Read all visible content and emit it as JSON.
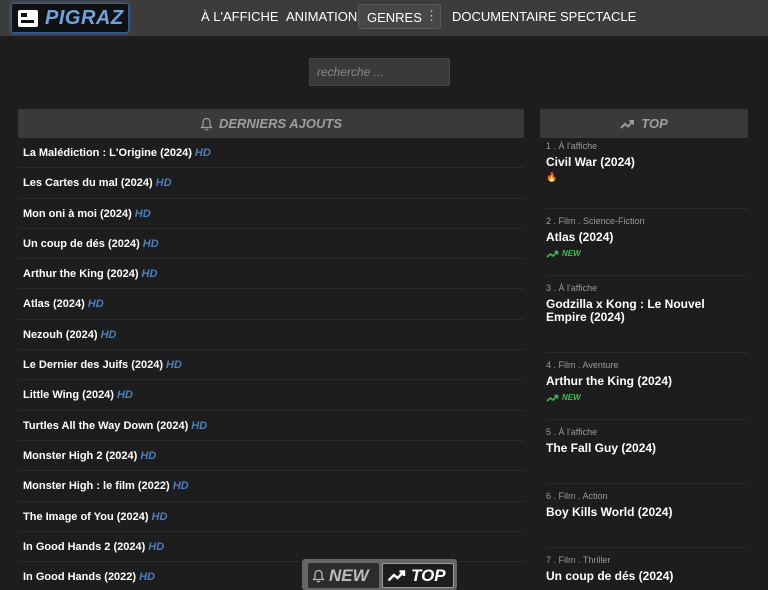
{
  "header": {
    "logo_text": "PIGRAZ",
    "nav": [
      {
        "label": "À L'AFFICHE"
      },
      {
        "label": "ANIMATION"
      },
      {
        "label": "GENRES"
      },
      {
        "label": "DOCUMENTAIRE"
      },
      {
        "label": "SPECTACLE"
      }
    ]
  },
  "search": {
    "placeholder": "recherche ..."
  },
  "latest": {
    "title": "DERNIERS AJOUTS",
    "items": [
      {
        "title": "La Malédiction : L'Origine (2024)",
        "tag": "HD"
      },
      {
        "title": "Les Cartes du mal (2024)",
        "tag": "HD"
      },
      {
        "title": "Mon oni à moi (2024)",
        "tag": "HD"
      },
      {
        "title": "Un coup de dés (2024)",
        "tag": "HD"
      },
      {
        "title": "Arthur the King (2024)",
        "tag": "HD"
      },
      {
        "title": "Atlas (2024)",
        "tag": "HD"
      },
      {
        "title": "Nezouh (2024)",
        "tag": "HD"
      },
      {
        "title": "Le Dernier des Juifs (2024)",
        "tag": "HD"
      },
      {
        "title": "Little Wing (2024)",
        "tag": "HD"
      },
      {
        "title": "Turtles All the Way Down (2024)",
        "tag": "HD"
      },
      {
        "title": "Monster High 2 (2024)",
        "tag": "HD"
      },
      {
        "title": "Monster High : le film (2022)",
        "tag": "HD"
      },
      {
        "title": "The Image of You (2024)",
        "tag": "HD"
      },
      {
        "title": "In Good Hands 2 (2024)",
        "tag": "HD"
      },
      {
        "title": "In Good Hands (2022)",
        "tag": "HD"
      }
    ]
  },
  "top": {
    "title": "TOP",
    "items": [
      {
        "category": "1 . À l'affiche",
        "title": "Civil War (2024)",
        "badge": "fire"
      },
      {
        "category": "2 . Film . Science-Fiction",
        "title": "Atlas (2024)",
        "badge": "NEW"
      },
      {
        "category": "3 . À l'affiche",
        "title": "Godzilla x Kong : Le Nouvel Empire (2024)",
        "badge": ""
      },
      {
        "category": "4 . Film . Aventure",
        "title": "Arthur the King (2024)",
        "badge": "NEW"
      },
      {
        "category": "5 . À l'affiche",
        "title": "The Fall Guy (2024)",
        "badge": ""
      },
      {
        "category": "6 . Film . Action",
        "title": "Boy Kills World (2024)",
        "badge": ""
      },
      {
        "category": "7 . Film . Thriller",
        "title": "Un coup de dés (2024)",
        "badge": ""
      }
    ]
  },
  "floating": {
    "new_label": "NEW",
    "top_label": "TOP"
  },
  "colors": {
    "accent_blue": "#4a7fc0",
    "new_green": "#3bbd4c",
    "background": "#1d1d1d"
  }
}
